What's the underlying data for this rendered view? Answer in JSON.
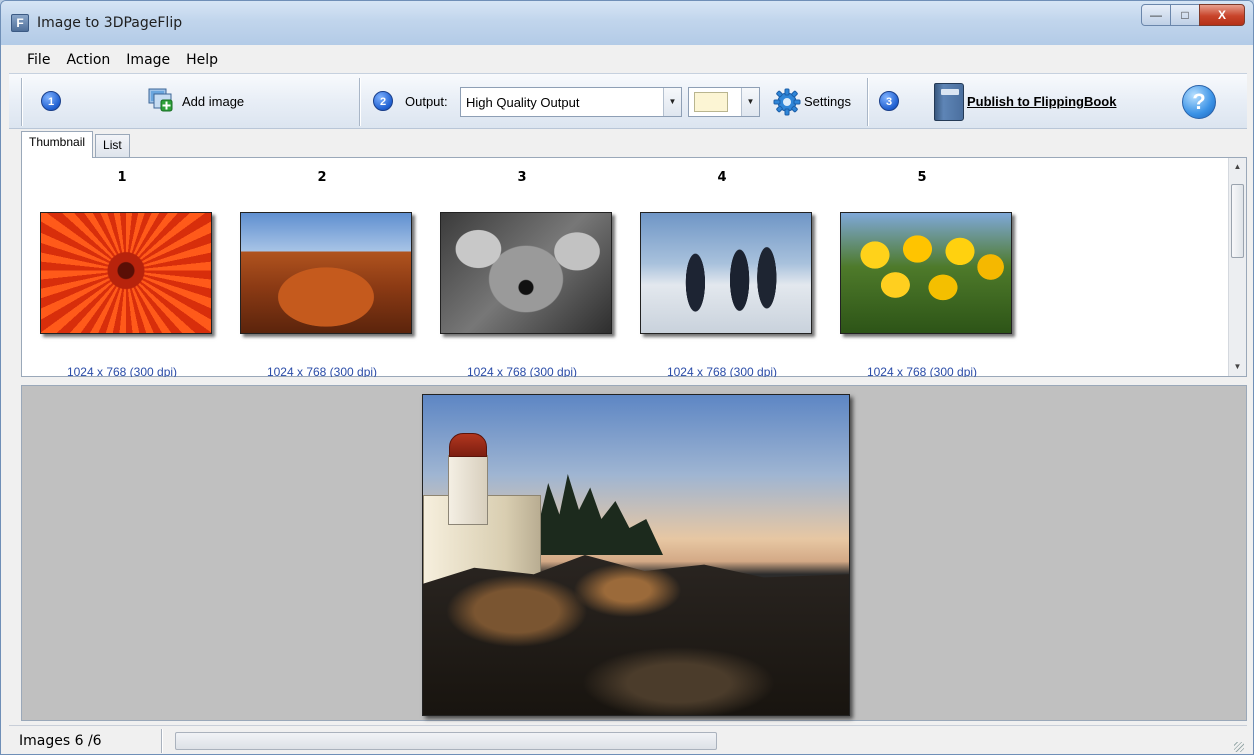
{
  "window": {
    "title": "Image to 3DPageFlip",
    "app_icon_glyph": "F",
    "controls": {
      "minimize": "—",
      "maximize": "□",
      "close": "X"
    }
  },
  "menu": [
    "File",
    "Action",
    "Image",
    "Help"
  ],
  "toolbar": {
    "step1": "1",
    "add_image_label": "Add image",
    "step2": "2",
    "output_label": "Output:",
    "output_value": "High Quality Output",
    "color_value": "#fcf5d4",
    "settings_label": "Settings",
    "step3": "3",
    "publish_label": "Publish to FlippingBook",
    "help_glyph": "?"
  },
  "tabs": [
    {
      "label": "Thumbnail",
      "active": true
    },
    {
      "label": "List",
      "active": false
    }
  ],
  "thumbnails": [
    {
      "number": "1",
      "info": "1024 x 768 (300 dpi)",
      "image": "red-flower"
    },
    {
      "number": "2",
      "info": "1024 x 768 (300 dpi)",
      "image": "desert"
    },
    {
      "number": "3",
      "info": "1024 x 768 (300 dpi)",
      "image": "koala"
    },
    {
      "number": "4",
      "info": "1024 x 768 (300 dpi)",
      "image": "penguins"
    },
    {
      "number": "5",
      "info": "1024 x 768 (300 dpi)",
      "image": "tulips"
    }
  ],
  "preview": {
    "image": "lighthouse"
  },
  "status": {
    "images_text": "Images 6 /6",
    "progress": 0.0
  }
}
